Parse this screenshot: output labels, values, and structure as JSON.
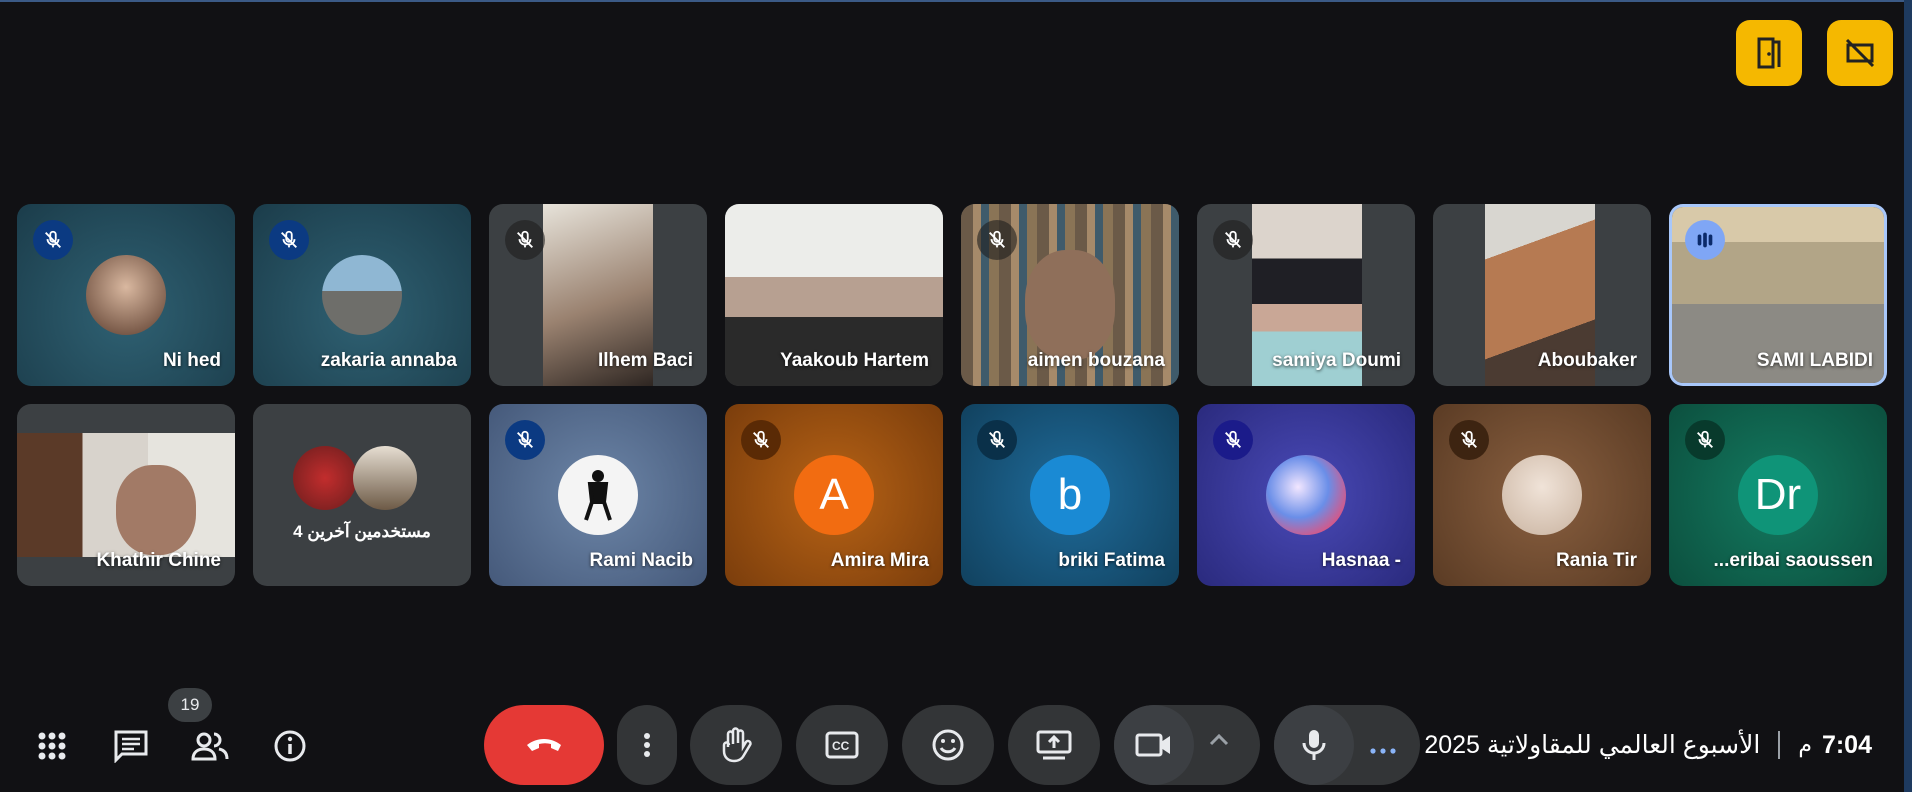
{
  "participants_row1": [
    {
      "name": "Ni hed",
      "muted": true
    },
    {
      "name": "zakaria annaba",
      "muted": true
    },
    {
      "name": "Ilhem Baci",
      "muted": true
    },
    {
      "name": "Yaakoub Hartem",
      "muted": false
    },
    {
      "name": "aimen bouzana",
      "muted": true
    },
    {
      "name": "samiya Doumi",
      "muted": true
    },
    {
      "name": "Aboubaker",
      "muted": false
    },
    {
      "name": "SAMI LABIDI",
      "muted": false,
      "speaking": true
    }
  ],
  "participants_row2": [
    {
      "name": "Khathir Chine",
      "muted": false
    },
    {
      "name": "4 مستخدمين آخرين",
      "muted": false
    },
    {
      "name": "Rami Nacib",
      "muted": true
    },
    {
      "name": "Amira Mira",
      "muted": true,
      "initial": "A"
    },
    {
      "name": "briki Fatima",
      "muted": true,
      "initial": "b"
    },
    {
      "name": "Hasnaa -",
      "muted": true
    },
    {
      "name": "Rania Tir",
      "muted": true
    },
    {
      "name": "...eribai saoussen",
      "muted": true,
      "initial": "Dr"
    }
  ],
  "people_count": "19",
  "meeting": {
    "time": "7:04",
    "ampm": "م",
    "title": "الأسبوع العالمي للمقاولاتية 2025"
  },
  "colors": {
    "accent": "#f5b800",
    "hangup": "#e53935",
    "control": "#333537",
    "background": "#111114"
  },
  "icons": {
    "top": [
      "door-icon",
      "no-rotate-screen-icon"
    ],
    "left": [
      "apps-icon",
      "chat-icon",
      "people-icon",
      "info-icon"
    ],
    "controls": [
      "hangup-icon",
      "more-vert-icon",
      "raise-hand-icon",
      "captions-icon",
      "emoji-icon",
      "present-screen-icon",
      "camera-icon",
      "chevron-up-icon",
      "microphone-icon",
      "more-horiz-icon"
    ]
  }
}
